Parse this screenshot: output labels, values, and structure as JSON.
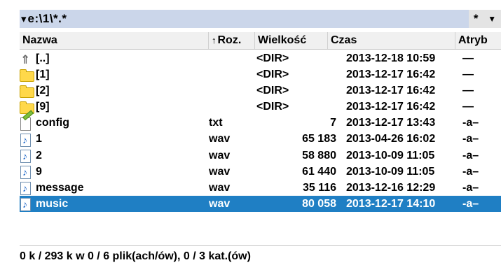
{
  "pathbar": {
    "path": "e:\\1\\*.*",
    "dropdown_icon": "triangle-down",
    "right_star": "*",
    "right_arrow": "▼"
  },
  "columns": {
    "name": "Nazwa",
    "ext": "Roz.",
    "ext_sort_arrow": "↑",
    "size": "Wielkość",
    "time": "Czas",
    "attr": "Atryb"
  },
  "rows": [
    {
      "icon": "up-dir-icon",
      "name": "[..]",
      "ext": "",
      "size": "<DIR>",
      "time": "2013-12-18 10:59",
      "attr": "—",
      "selected": false
    },
    {
      "icon": "folder-icon",
      "name": "[1]",
      "ext": "",
      "size": "<DIR>",
      "time": "2013-12-17 16:42",
      "attr": "—",
      "selected": false
    },
    {
      "icon": "folder-icon",
      "name": "[2]",
      "ext": "",
      "size": "<DIR>",
      "time": "2013-12-17 16:42",
      "attr": "—",
      "selected": false
    },
    {
      "icon": "folder-icon",
      "name": "[9]",
      "ext": "",
      "size": "<DIR>",
      "time": "2013-12-17 16:42",
      "attr": "—",
      "selected": false
    },
    {
      "icon": "text-file-icon",
      "name": "config",
      "ext": "txt",
      "size": "7",
      "time": "2013-12-17 13:43",
      "attr": "-a–",
      "selected": false
    },
    {
      "icon": "audio-file-icon",
      "name": "1",
      "ext": "wav",
      "size": "65 183",
      "time": "2013-04-26 16:02",
      "attr": "-a–",
      "selected": false
    },
    {
      "icon": "audio-file-icon",
      "name": "2",
      "ext": "wav",
      "size": "58 880",
      "time": "2013-10-09 11:05",
      "attr": "-a–",
      "selected": false
    },
    {
      "icon": "audio-file-icon",
      "name": "9",
      "ext": "wav",
      "size": "61 440",
      "time": "2013-10-09 11:05",
      "attr": "-a–",
      "selected": false
    },
    {
      "icon": "audio-file-icon",
      "name": "message",
      "ext": "wav",
      "size": "35 116",
      "time": "2013-12-16 12:29",
      "attr": "-a–",
      "selected": false
    },
    {
      "icon": "audio-file-icon",
      "name": "music",
      "ext": "wav",
      "size": "80 058",
      "time": "2013-12-17 14:10",
      "attr": "-a–",
      "selected": true
    }
  ],
  "status": "0 k / 293 k w 0 / 6 plik(ach/ów), 0 / 3 kat.(ów)",
  "colors": {
    "selection": "#1f7fc4",
    "pathbar": "#cbd6ea",
    "folder": "#ffd84a"
  }
}
